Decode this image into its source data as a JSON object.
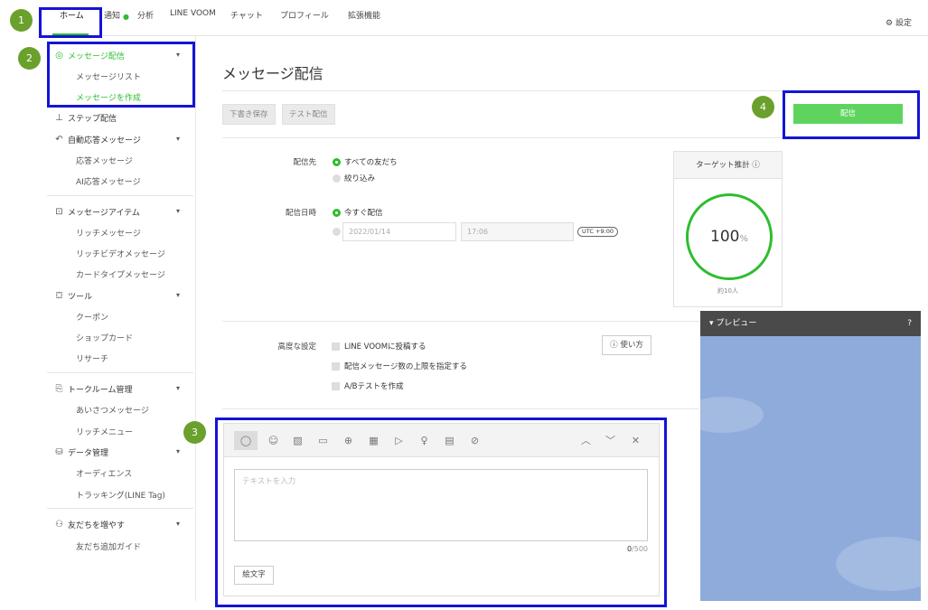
{
  "topnav": {
    "items": [
      "ホーム",
      "通知",
      "分析",
      "LINE VOOM",
      "チャット",
      "プロフィール",
      "拡張機能"
    ],
    "settings_label": "設定"
  },
  "sidebar": {
    "broadcast": "メッセージ配信",
    "message_list": "メッセージリスト",
    "create_message": "メッセージを作成",
    "step": "ステップ配信",
    "auto_reply": "自動応答メッセージ",
    "reply_message": "応答メッセージ",
    "ai_reply": "AI応答メッセージ",
    "message_items": "メッセージアイテム",
    "rich_message": "リッチメッセージ",
    "rich_video": "リッチビデオメッセージ",
    "card_type": "カードタイプメッセージ",
    "tools": "ツール",
    "coupon": "クーポン",
    "shop_card": "ショップカード",
    "research": "リサーチ",
    "talk_room": "トークルーム管理",
    "greeting": "あいさつメッセージ",
    "rich_menu": "リッチメニュー",
    "data_mgmt": "データ管理",
    "audience": "オーディエンス",
    "tracking": "トラッキング(LINE Tag)",
    "grow_friends": "友だちを増やす",
    "add_friend_guide": "友だち追加ガイド"
  },
  "main": {
    "title": "メッセージ配信",
    "save_draft": "下書き保存",
    "test_send": "テスト配信",
    "send": "配信",
    "recipients_label": "配信先",
    "all_friends": "すべての友だち",
    "filter": "絞り込み",
    "datetime_label": "配信日時",
    "send_now": "今すぐ配信",
    "date_value": "2022/01/14",
    "time_value": "17:06",
    "utc": "UTC +9:00",
    "target_title": "ターゲット推計",
    "target_percent": "100",
    "target_percent_unit": "%",
    "target_count": "約10人",
    "advanced_label": "高度な設定",
    "post_voom": "LINE VOOMに投稿する",
    "limit_count": "配信メッセージ数の上限を指定する",
    "ab_test": "A/Bテストを作成",
    "usage": "使い方"
  },
  "preview": {
    "title": "プレビュー"
  },
  "editor": {
    "placeholder": "テキストを入力",
    "count": "0",
    "max": "/500",
    "emoji_button": "絵文字"
  },
  "annotations": [
    "1",
    "2",
    "3",
    "4"
  ],
  "colors": {
    "accent": "#2ebd2e",
    "send_button": "#5ed45e",
    "highlight_box": "#1414d6",
    "badge": "#6aa02c",
    "preview_bg": "#8fabdb"
  }
}
